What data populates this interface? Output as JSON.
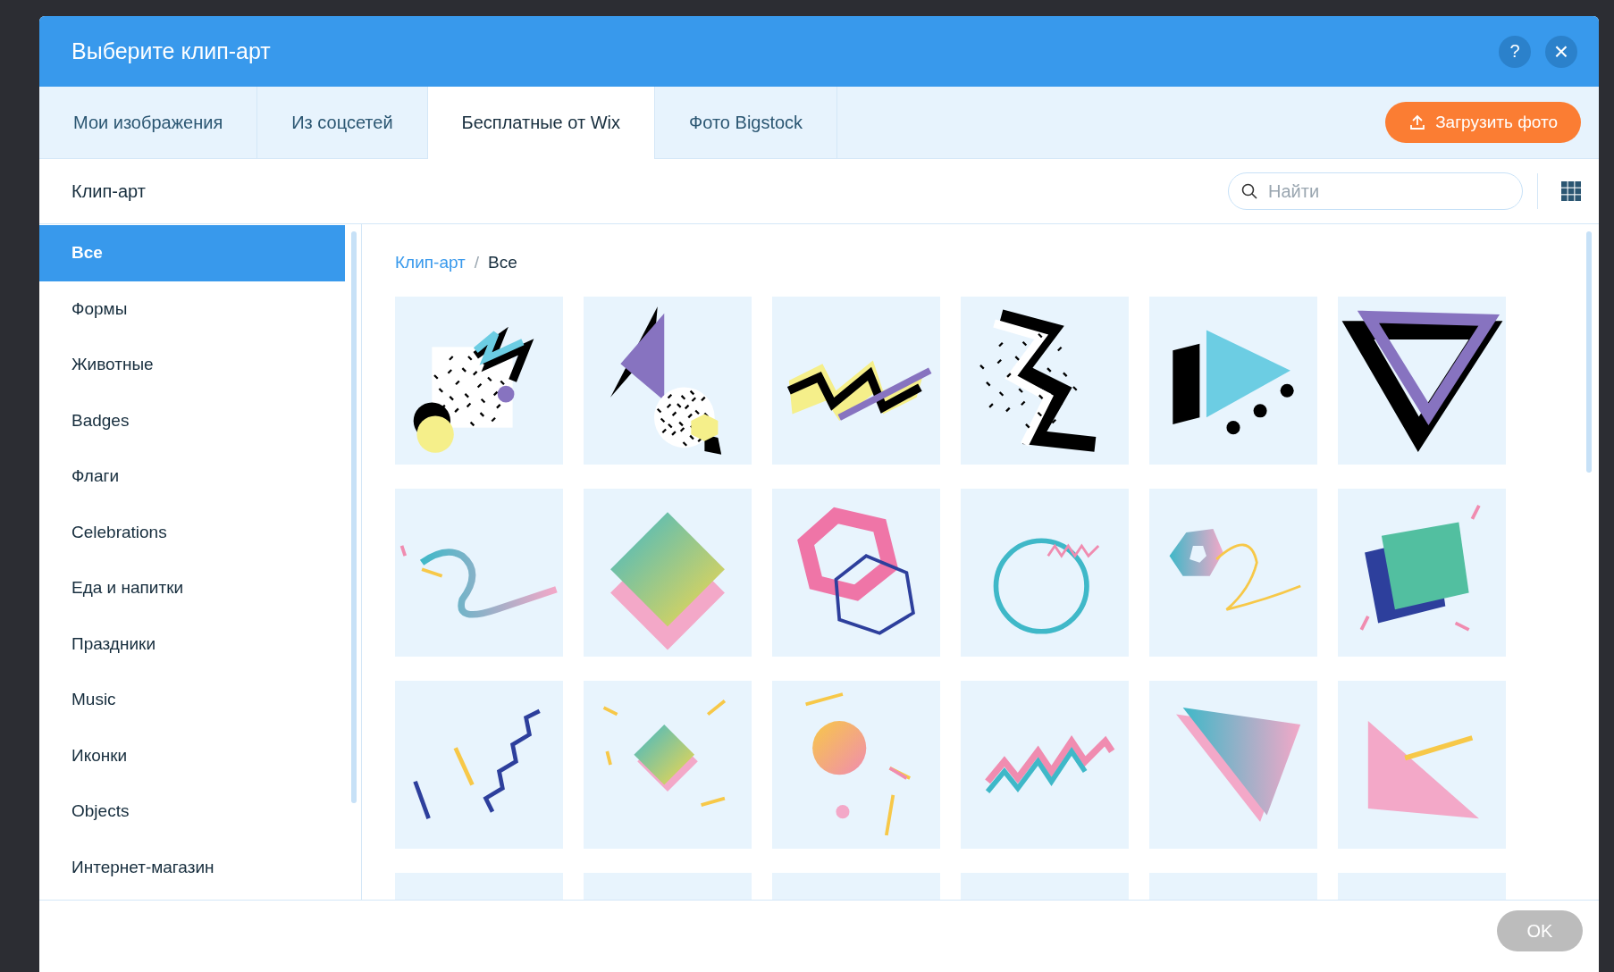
{
  "dialog": {
    "title": "Выберите клип-арт",
    "help": "?",
    "close": "×"
  },
  "tabs": [
    {
      "label": "Мои изображения",
      "selected": false
    },
    {
      "label": "Из соцсетей",
      "selected": false
    },
    {
      "label": "Бесплатные от Wix",
      "selected": true
    },
    {
      "label": "Фото Bigstock",
      "selected": false
    }
  ],
  "upload_button": "Загрузить фото",
  "section_title": "Клип-арт",
  "search": {
    "placeholder": "Найти"
  },
  "sidebar": {
    "items": [
      {
        "label": "Все",
        "selected": true
      },
      {
        "label": "Формы",
        "selected": false
      },
      {
        "label": "Животные",
        "selected": false
      },
      {
        "label": "Badges",
        "selected": false
      },
      {
        "label": "Флаги",
        "selected": false
      },
      {
        "label": "Celebrations",
        "selected": false
      },
      {
        "label": "Еда и напитки",
        "selected": false
      },
      {
        "label": "Праздники",
        "selected": false
      },
      {
        "label": "Music",
        "selected": false
      },
      {
        "label": "Иконки",
        "selected": false
      },
      {
        "label": "Objects",
        "selected": false
      },
      {
        "label": "Интернет-магазин",
        "selected": false
      }
    ]
  },
  "breadcrumb": {
    "parent": "Клип-арт",
    "separator": "/",
    "current": "Все"
  },
  "footer": {
    "ok_button": "OK",
    "ok_disabled": true
  }
}
